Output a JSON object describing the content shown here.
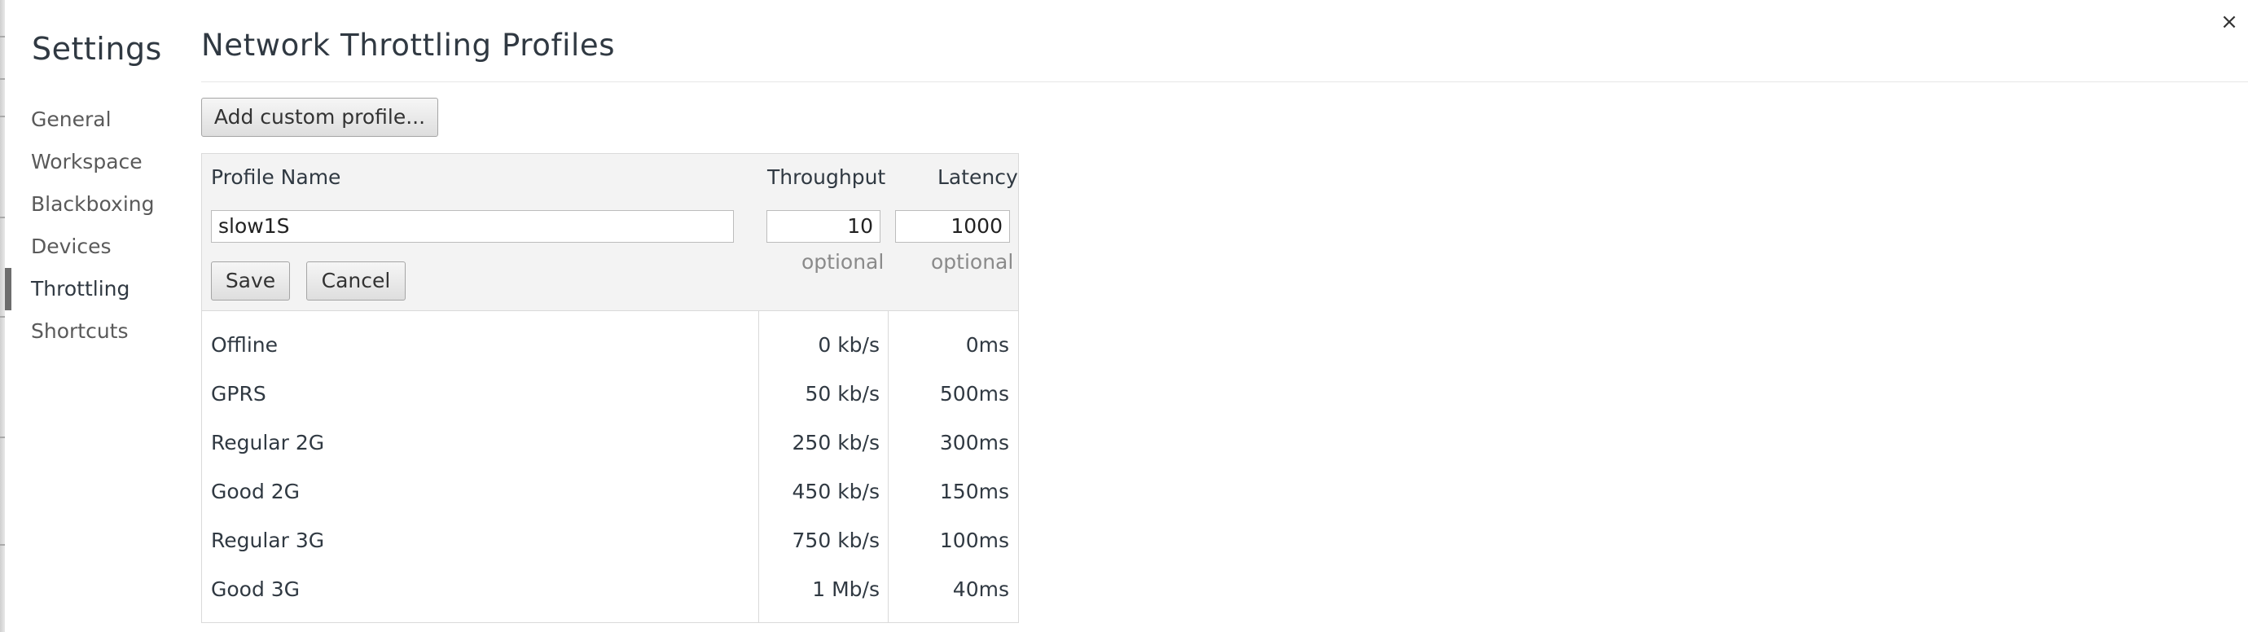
{
  "window": {
    "close_glyph": "×"
  },
  "sidebar": {
    "title": "Settings",
    "items": [
      {
        "label": "General",
        "selected": false
      },
      {
        "label": "Workspace",
        "selected": false
      },
      {
        "label": "Blackboxing",
        "selected": false
      },
      {
        "label": "Devices",
        "selected": false
      },
      {
        "label": "Throttling",
        "selected": true
      },
      {
        "label": "Shortcuts",
        "selected": false
      }
    ]
  },
  "main": {
    "title": "Network Throttling Profiles",
    "add_button_label": "Add custom profile..."
  },
  "editor": {
    "headers": {
      "name": "Profile Name",
      "throughput": "Throughput",
      "latency": "Latency"
    },
    "values": {
      "name": "slow1S",
      "throughput": "10",
      "latency": "1000"
    },
    "hints": {
      "throughput": "optional",
      "latency": "optional"
    },
    "save_label": "Save",
    "cancel_label": "Cancel"
  },
  "profiles": [
    {
      "name": "Offline",
      "throughput": "0 kb/s",
      "latency": "0ms"
    },
    {
      "name": "GPRS",
      "throughput": "50 kb/s",
      "latency": "500ms"
    },
    {
      "name": "Regular 2G",
      "throughput": "250 kb/s",
      "latency": "300ms"
    },
    {
      "name": "Good 2G",
      "throughput": "450 kb/s",
      "latency": "150ms"
    },
    {
      "name": "Regular 3G",
      "throughput": "750 kb/s",
      "latency": "100ms"
    },
    {
      "name": "Good 3G",
      "throughput": "1 Mb/s",
      "latency": "40ms"
    }
  ]
}
